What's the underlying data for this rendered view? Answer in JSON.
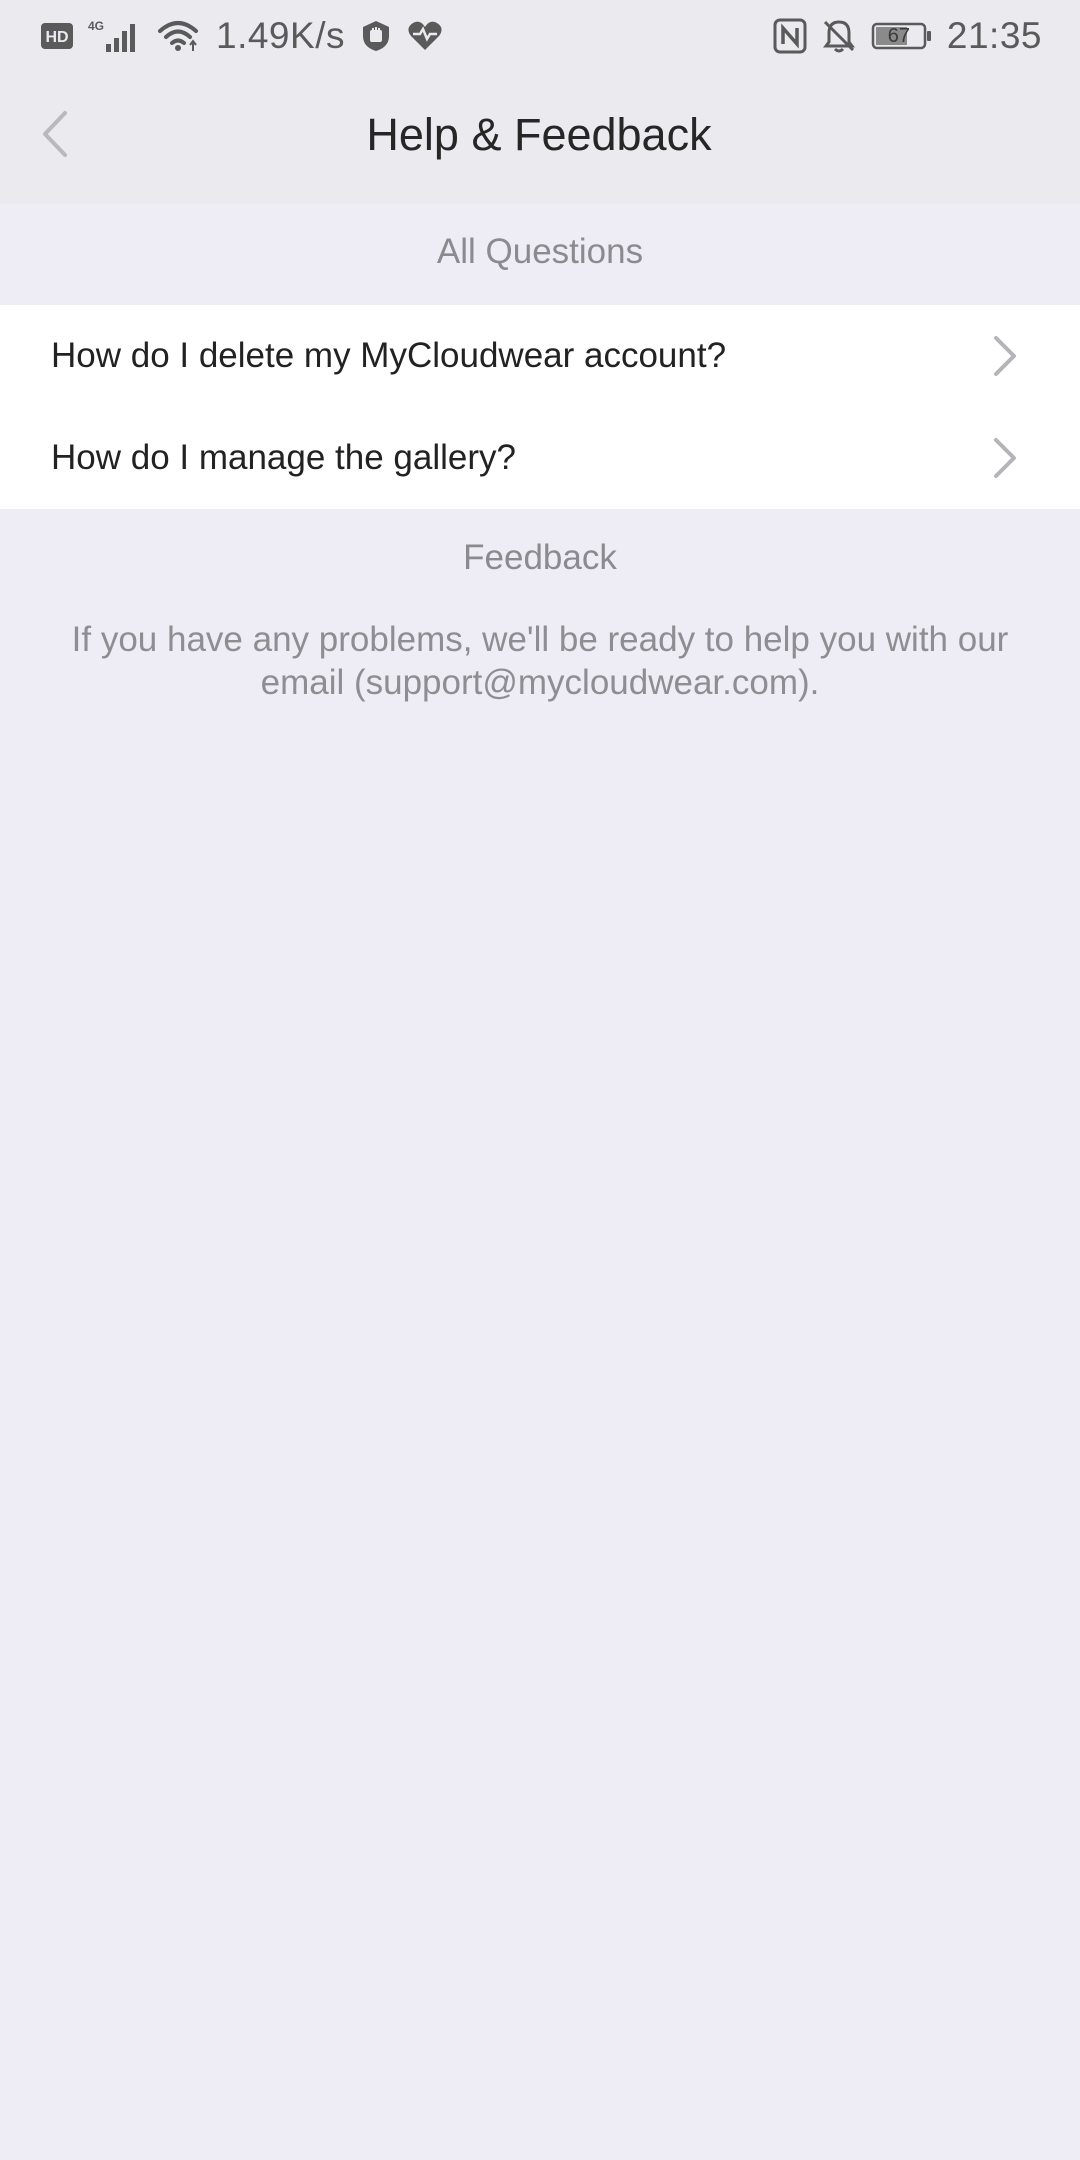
{
  "status_bar": {
    "network_speed": "1.49K/s",
    "battery_level": "67",
    "time": "21:35",
    "icons": [
      "hd-icon",
      "signal-4g-icon",
      "wifi-icon",
      "speed-text",
      "shield-hand-icon",
      "heart-rate-icon",
      "nfc-icon",
      "bell-off-icon",
      "battery-icon"
    ]
  },
  "header": {
    "title": "Help & Feedback",
    "back_icon": "chevron-left-icon"
  },
  "questions": {
    "section_title": "All Questions",
    "items": [
      {
        "label": "How do I delete my MyCloudwear account?",
        "icon": "chevron-right-icon"
      },
      {
        "label": "How do I manage the gallery?",
        "icon": "chevron-right-icon"
      }
    ]
  },
  "feedback": {
    "section_title": "Feedback",
    "body": "If you have any problems, we'll be ready to help you with our email (support@mycloudwear.com)."
  },
  "colors": {
    "background": "#eeecf5",
    "header_background": "#ebeaef",
    "list_background": "#ffffff",
    "secondary_text": "#8b8b8f",
    "primary_text": "#222222"
  }
}
